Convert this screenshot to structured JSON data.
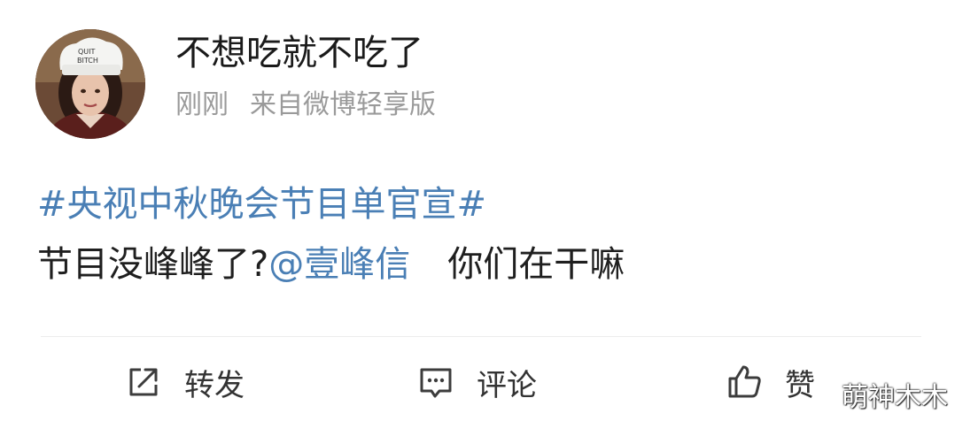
{
  "post": {
    "author": {
      "name": "不想吃就不吃了"
    },
    "time": "刚刚",
    "source": "来自微博轻享版",
    "content": {
      "hashtag": "#央视中秋晚会节目单官宣#",
      "text_before_mention": "节目没峰峰了?",
      "mention": "@壹峰信",
      "text_after_mention": "你们在干嘛"
    },
    "avatar_hat_text": [
      "QUIT",
      "BITCH"
    ]
  },
  "actions": {
    "repost_label": "转发",
    "comment_label": "评论",
    "like_label": "赞"
  },
  "watermark": "萌神木木",
  "icons": {
    "repost": "share-arrow-icon",
    "comment": "comment-bubble-icon",
    "like": "thumbs-up-icon"
  }
}
